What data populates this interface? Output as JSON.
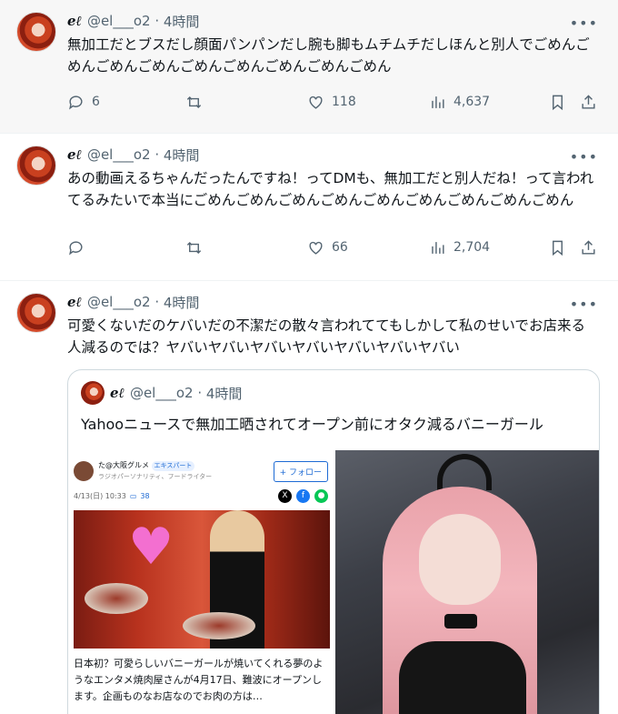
{
  "tweets": [
    {
      "display_name": "eℓ",
      "handle": "@el___o2",
      "time": "4時間",
      "text": "無加工だとブスだし顔面パンパンだし腕も脚もムチムチだしほんと別人でごめんごめんごめんごめんごめんごめんごめんごめんごめん",
      "replies": "6",
      "likes": "118",
      "views": "4,637"
    },
    {
      "display_name": "eℓ",
      "handle": "@el___o2",
      "time": "4時間",
      "text": "あの動画えるちゃんだったんですね！ってDMも、無加工だと別人だね！って言われてるみたいで本当にごめんごめんごめんごめんごめんごめんごめんごめんごめん",
      "replies": "",
      "likes": "66",
      "views": "2,704"
    },
    {
      "display_name": "eℓ",
      "handle": "@el___o2",
      "time": "4時間",
      "text": "可愛くないだのケバいだの不潔だの散々言われててもしかして私のせいでお店来る人減るのでは？ヤバいヤバいヤバいヤバいヤバいヤバいヤバい"
    }
  ],
  "quote": {
    "display_name": "eℓ",
    "handle": "@el___o2",
    "time": "4時間",
    "text": "Yahooニュースで無加工晒されてオープン前にオタク減るバニーガール"
  },
  "article": {
    "author": "た@大阪グルメ",
    "expert_badge": "エキスパート",
    "role": "ラジオパーソナリティ、フードライター",
    "follow_label": "+ フォロー",
    "date": "4/13(日) 10:33",
    "comment_count": "38",
    "body": "日本初？可愛らしいバニーガールが焼いてくれる夢のようなエンタメ焼肉屋さんが4月17日、難波にオープンします。企画ものなお店なのでお肉の方は…"
  },
  "icons": {
    "reply": "reply-icon",
    "retweet": "retweet-icon",
    "like": "heart-icon",
    "views": "views-icon",
    "bookmark": "bookmark-icon",
    "share": "share-icon",
    "more": "more-icon"
  },
  "colors": {
    "text": "#0f1419",
    "muted": "#536471",
    "border": "#cfd9de"
  }
}
